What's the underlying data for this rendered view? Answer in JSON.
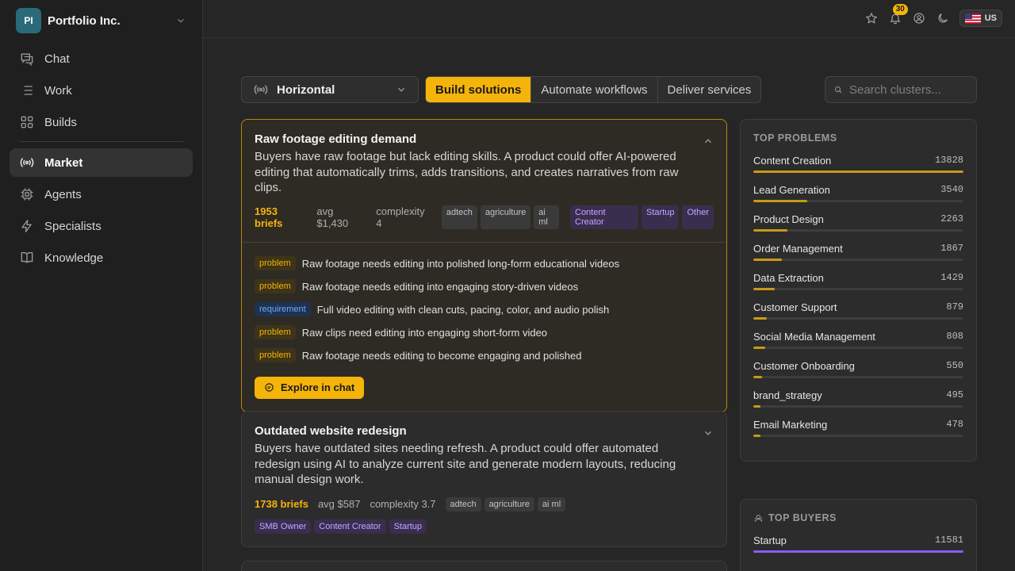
{
  "org": {
    "initials": "PI",
    "name": "Portfolio Inc."
  },
  "nav": [
    {
      "label": "Chat",
      "icon": "chat-icon"
    },
    {
      "label": "Work",
      "icon": "list-icon"
    },
    {
      "label": "Builds",
      "icon": "grid-icon"
    },
    {
      "label": "Market",
      "icon": "broadcast-icon",
      "active": true
    },
    {
      "label": "Agents",
      "icon": "cpu-icon"
    },
    {
      "label": "Specialists",
      "icon": "bolt-icon"
    },
    {
      "label": "Knowledge",
      "icon": "book-icon"
    }
  ],
  "topbar": {
    "notifications": "30",
    "locale": "US"
  },
  "controls": {
    "view": "Horizontal",
    "segments": [
      "Build solutions",
      "Automate workflows",
      "Deliver services"
    ],
    "active_segment": 0,
    "search_placeholder": "Search clusters..."
  },
  "cards": [
    {
      "title": "Raw footage editing demand",
      "description": "Buyers have raw footage but lack editing skills. A product could offer AI-powered editing that automatically trims, adds transitions, and creates narratives from raw clips.",
      "briefs": "1953 briefs",
      "avg": "avg $1,430",
      "complexity": "complexity 4",
      "industries": [
        "adtech",
        "agriculture",
        "ai ml"
      ],
      "buyers": [
        "Content Creator",
        "Startup",
        "Other"
      ],
      "signals": [
        {
          "type": "problem",
          "text": "Raw footage needs editing into polished long-form educational videos"
        },
        {
          "type": "problem",
          "text": "Raw footage needs editing into engaging story-driven videos"
        },
        {
          "type": "requirement",
          "text": "Full video editing with clean cuts, pacing, color, and audio polish"
        },
        {
          "type": "problem",
          "text": "Raw clips need editing into engaging short-form video"
        },
        {
          "type": "problem",
          "text": "Raw footage needs editing to become engaging and polished"
        }
      ],
      "cta": "Explore in chat"
    },
    {
      "title": "Outdated website redesign",
      "description": "Buyers have outdated sites needing refresh. A product could offer automated redesign using AI to analyze current site and generate modern layouts, reducing manual design work.",
      "briefs": "1738 briefs",
      "avg": "avg $587",
      "complexity": "complexity 3.7",
      "industries": [
        "adtech",
        "agriculture",
        "ai ml"
      ],
      "buyers": [
        "SMB Owner",
        "Content Creator",
        "Startup"
      ]
    }
  ],
  "top_problems": {
    "title": "TOP PROBLEMS",
    "max": 13828,
    "items": [
      {
        "name": "Content Creation",
        "value": 13828
      },
      {
        "name": "Lead Generation",
        "value": 3540
      },
      {
        "name": "Product Design",
        "value": 2263
      },
      {
        "name": "Order Management",
        "value": 1867
      },
      {
        "name": "Data Extraction",
        "value": 1429
      },
      {
        "name": "Customer Support",
        "value": 879
      },
      {
        "name": "Social Media Management",
        "value": 808
      },
      {
        "name": "Customer Onboarding",
        "value": 550
      },
      {
        "name": "brand_strategy",
        "value": 495
      },
      {
        "name": "Email Marketing",
        "value": 478
      }
    ]
  },
  "top_buyers": {
    "title": "TOP BUYERS",
    "max": 11581,
    "items": [
      {
        "name": "Startup",
        "value": 11581
      }
    ]
  },
  "colors": {
    "accent": "#f5b40a",
    "purple": "#8b5cf6"
  }
}
